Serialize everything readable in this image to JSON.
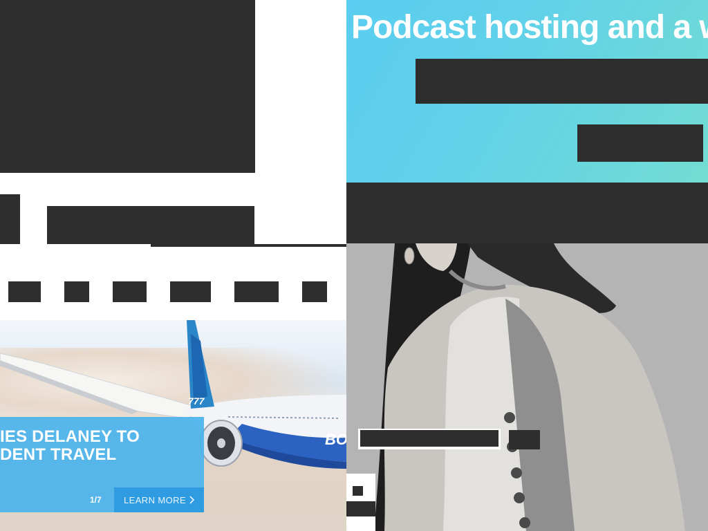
{
  "left_column": {
    "hero": {
      "headline": "IES DELANEY TO\nDENT TRAVEL",
      "counter": "1/7",
      "cta_label": "LEARN MORE",
      "cta_icon": "chevron-right-icon",
      "aircraft_tail_text": "777",
      "aircraft_body_text": "BO"
    }
  },
  "right_column": {
    "banner": {
      "title": "Podcast hosting and a w"
    }
  },
  "colors": {
    "accent_blue": "#4ab2ec",
    "cta_blue": "#2f9be0",
    "banner_gradient_start": "#5acdf0",
    "banner_gradient_end": "#72dcd2",
    "redaction": "#2d2d2d"
  }
}
